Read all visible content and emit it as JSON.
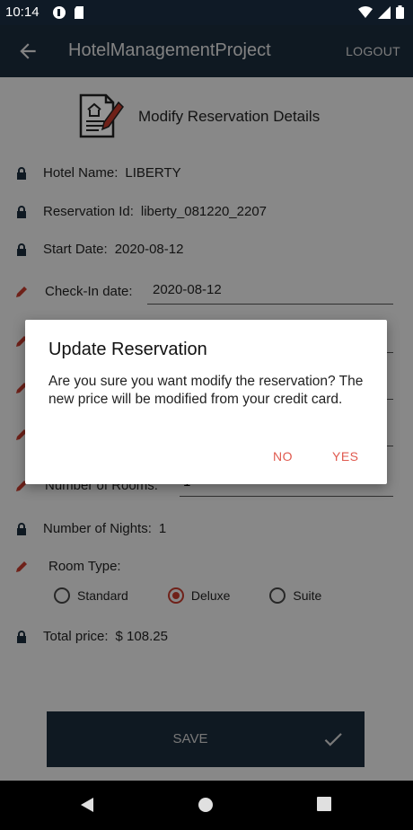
{
  "status_bar": {
    "time": "10:14"
  },
  "app_bar": {
    "title": "HotelManagementProject",
    "logout": "LOGOUT"
  },
  "header": {
    "title": "Modify Reservation Details"
  },
  "fields": {
    "hotel_name": {
      "label": "Hotel Name:",
      "value": "LIBERTY"
    },
    "reservation_id": {
      "label": "Reservation Id:",
      "value": "liberty_081220_2207"
    },
    "start_date": {
      "label": "Start Date:",
      "value": "2020-08-12"
    },
    "check_in": {
      "label": "Check-In date:",
      "value": "2020-08-12"
    },
    "number_of_rooms": {
      "label": "Number of Rooms:",
      "value": "1"
    },
    "number_of_nights": {
      "label": "Number of Nights:",
      "value": "1"
    },
    "room_type": {
      "label": "Room Type:",
      "options": [
        "Standard",
        "Deluxe",
        "Suite"
      ],
      "selected": "Deluxe"
    },
    "total_price": {
      "label": "Total price:",
      "value": "$ 108.25"
    }
  },
  "save_button": {
    "label": "SAVE"
  },
  "dialog": {
    "title": "Update Reservation",
    "message": "Are you sure you want modify the reservation? The new price will be modified from your credit card.",
    "no": "NO",
    "yes": "YES"
  },
  "colors": {
    "app_bar": "#1b2b3c",
    "accent": "#e05a4f",
    "lock": "#1b2b3c",
    "edit": "#c0392b"
  }
}
